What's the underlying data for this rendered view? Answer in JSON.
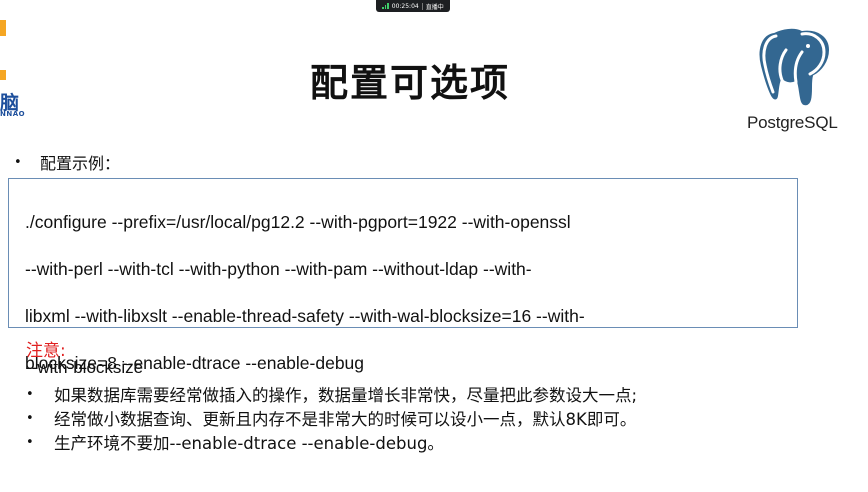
{
  "live_indicator": {
    "time": "00:25:04",
    "status": "直播中",
    "signal_color": "#3fcf6a"
  },
  "left_logo": {
    "text": "脑",
    "sub_text": "NNAO",
    "colors": {
      "bar": "#f5a623",
      "text": "#1d4f9c"
    }
  },
  "slide": {
    "title": "配置可选项",
    "pg_logo_text": "PostgreSQL",
    "pg_logo_colors": {
      "stroke": "#336791",
      "fill": "#ffffff"
    },
    "intro_bullet": "配置示例：",
    "code_lines": [
      "./configure --prefix=/usr/local/pg12.2 --with-pgport=1922  --with-openssl",
      "--with-perl --with-tcl --with-python --with-pam --without-ldap --with-",
      "libxml --with-libxslt --enable-thread-safety --with-wal-blocksize=16 --with-",
      "blocksize=8 --enable-dtrace --enable-debug"
    ],
    "notice_label": "注意:",
    "notice_color": "#e02020",
    "option_name": "--with-blocksize",
    "notes": [
      "如果数据库需要经常做插入的操作，数据量增长非常快，尽量把此参数设大一点;",
      "经常做小数据查询、更新且内存不是非常大的时候可以设小一点，默认8K即可。",
      "生产环境不要加--enable-dtrace --enable-debug。"
    ]
  }
}
